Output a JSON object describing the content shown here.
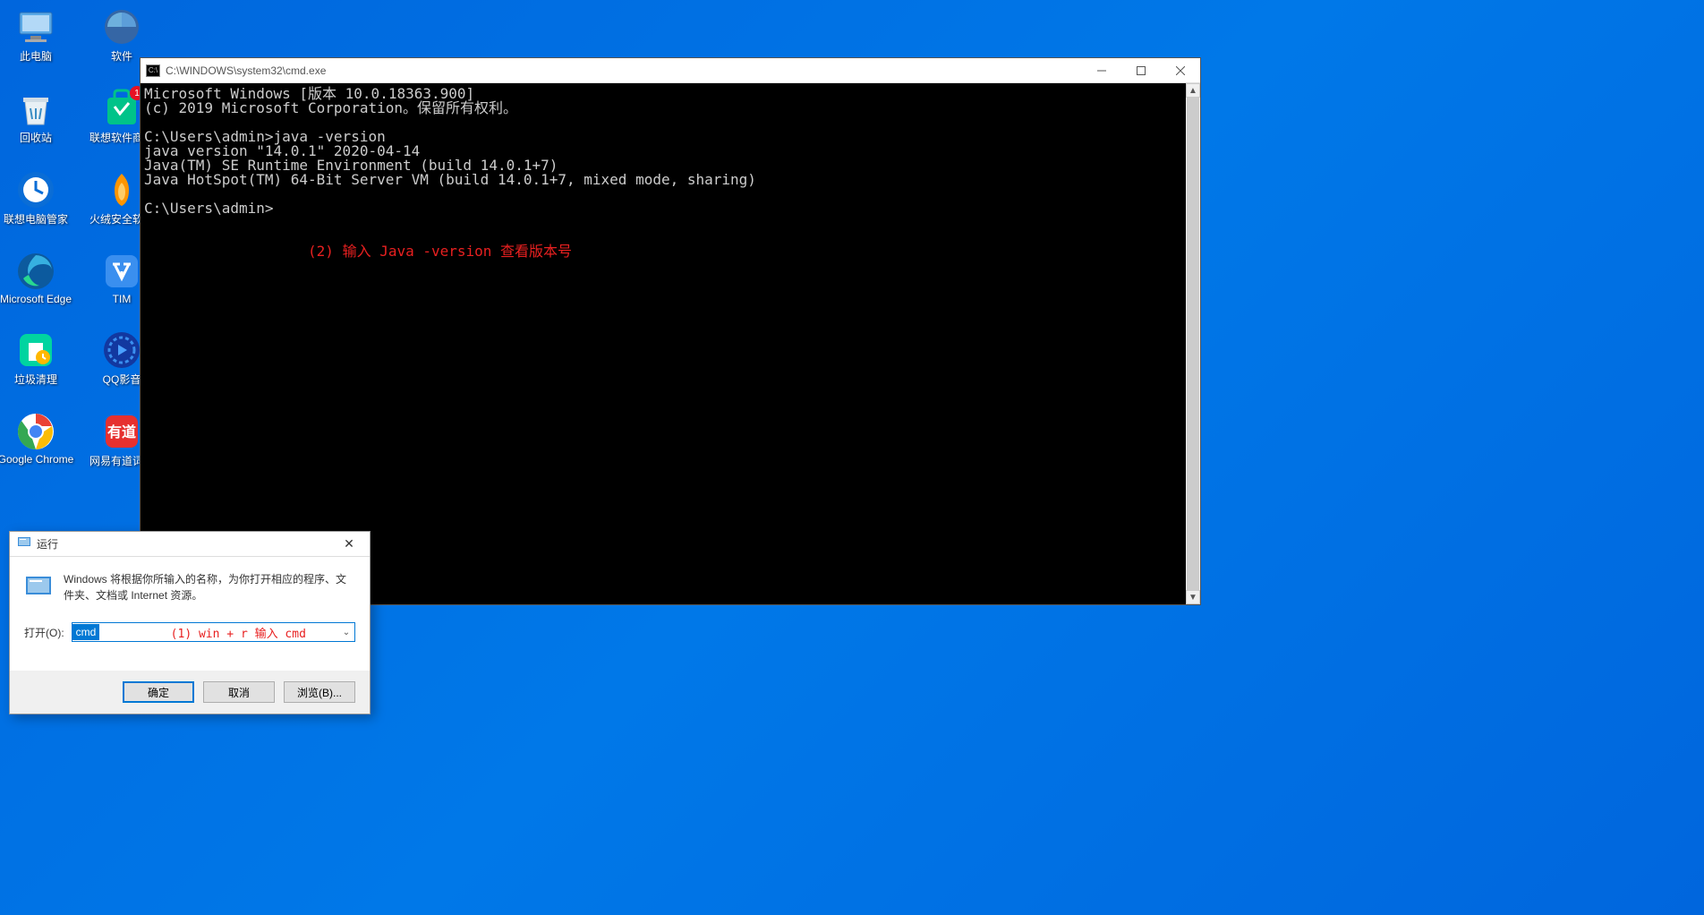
{
  "desktop": {
    "icons": [
      {
        "label": "此电脑",
        "name": "this-pc"
      },
      {
        "label": "软件",
        "name": "software-folder"
      },
      {
        "label": "回收站",
        "name": "recycle-bin"
      },
      {
        "label": "联想软件商店",
        "name": "lenovo-store",
        "badge": "1"
      },
      {
        "label": "联想电脑管家",
        "name": "lenovo-manager"
      },
      {
        "label": "火绒安全软件",
        "name": "huorong"
      },
      {
        "label": "Microsoft Edge",
        "name": "edge"
      },
      {
        "label": "TIM",
        "name": "tim"
      },
      {
        "label": "垃圾清理",
        "name": "trash-clean"
      },
      {
        "label": "QQ影音",
        "name": "qq-player"
      },
      {
        "label": "Google Chrome",
        "name": "chrome"
      },
      {
        "label": "网易有道词典",
        "name": "youdao"
      }
    ]
  },
  "cmd": {
    "title": "C:\\WINDOWS\\system32\\cmd.exe",
    "lines": {
      "l1": "Microsoft Windows [版本 10.0.18363.900]",
      "l2": "(c) 2019 Microsoft Corporation。保留所有权利。",
      "l3": "",
      "l4": "C:\\Users\\admin>java -version",
      "l5": "java version \"14.0.1\" 2020-04-14",
      "l6": "Java(TM) SE Runtime Environment (build 14.0.1+7)",
      "l7": "Java HotSpot(TM) 64-Bit Server VM (build 14.0.1+7, mixed mode, sharing)",
      "l8": "",
      "l9": "C:\\Users\\admin>"
    },
    "annotation": "(2) 输入 Java -version 查看版本号"
  },
  "run": {
    "title": "运行",
    "description": "Windows 将根据你所输入的名称，为你打开相应的程序、文件夹、文档或 Internet 资源。",
    "open_label": "打开(O):",
    "input_value": "cmd",
    "annotation": "(1)  win + r  输入 cmd",
    "buttons": {
      "ok": "确定",
      "cancel": "取消",
      "browse": "浏览(B)..."
    }
  }
}
